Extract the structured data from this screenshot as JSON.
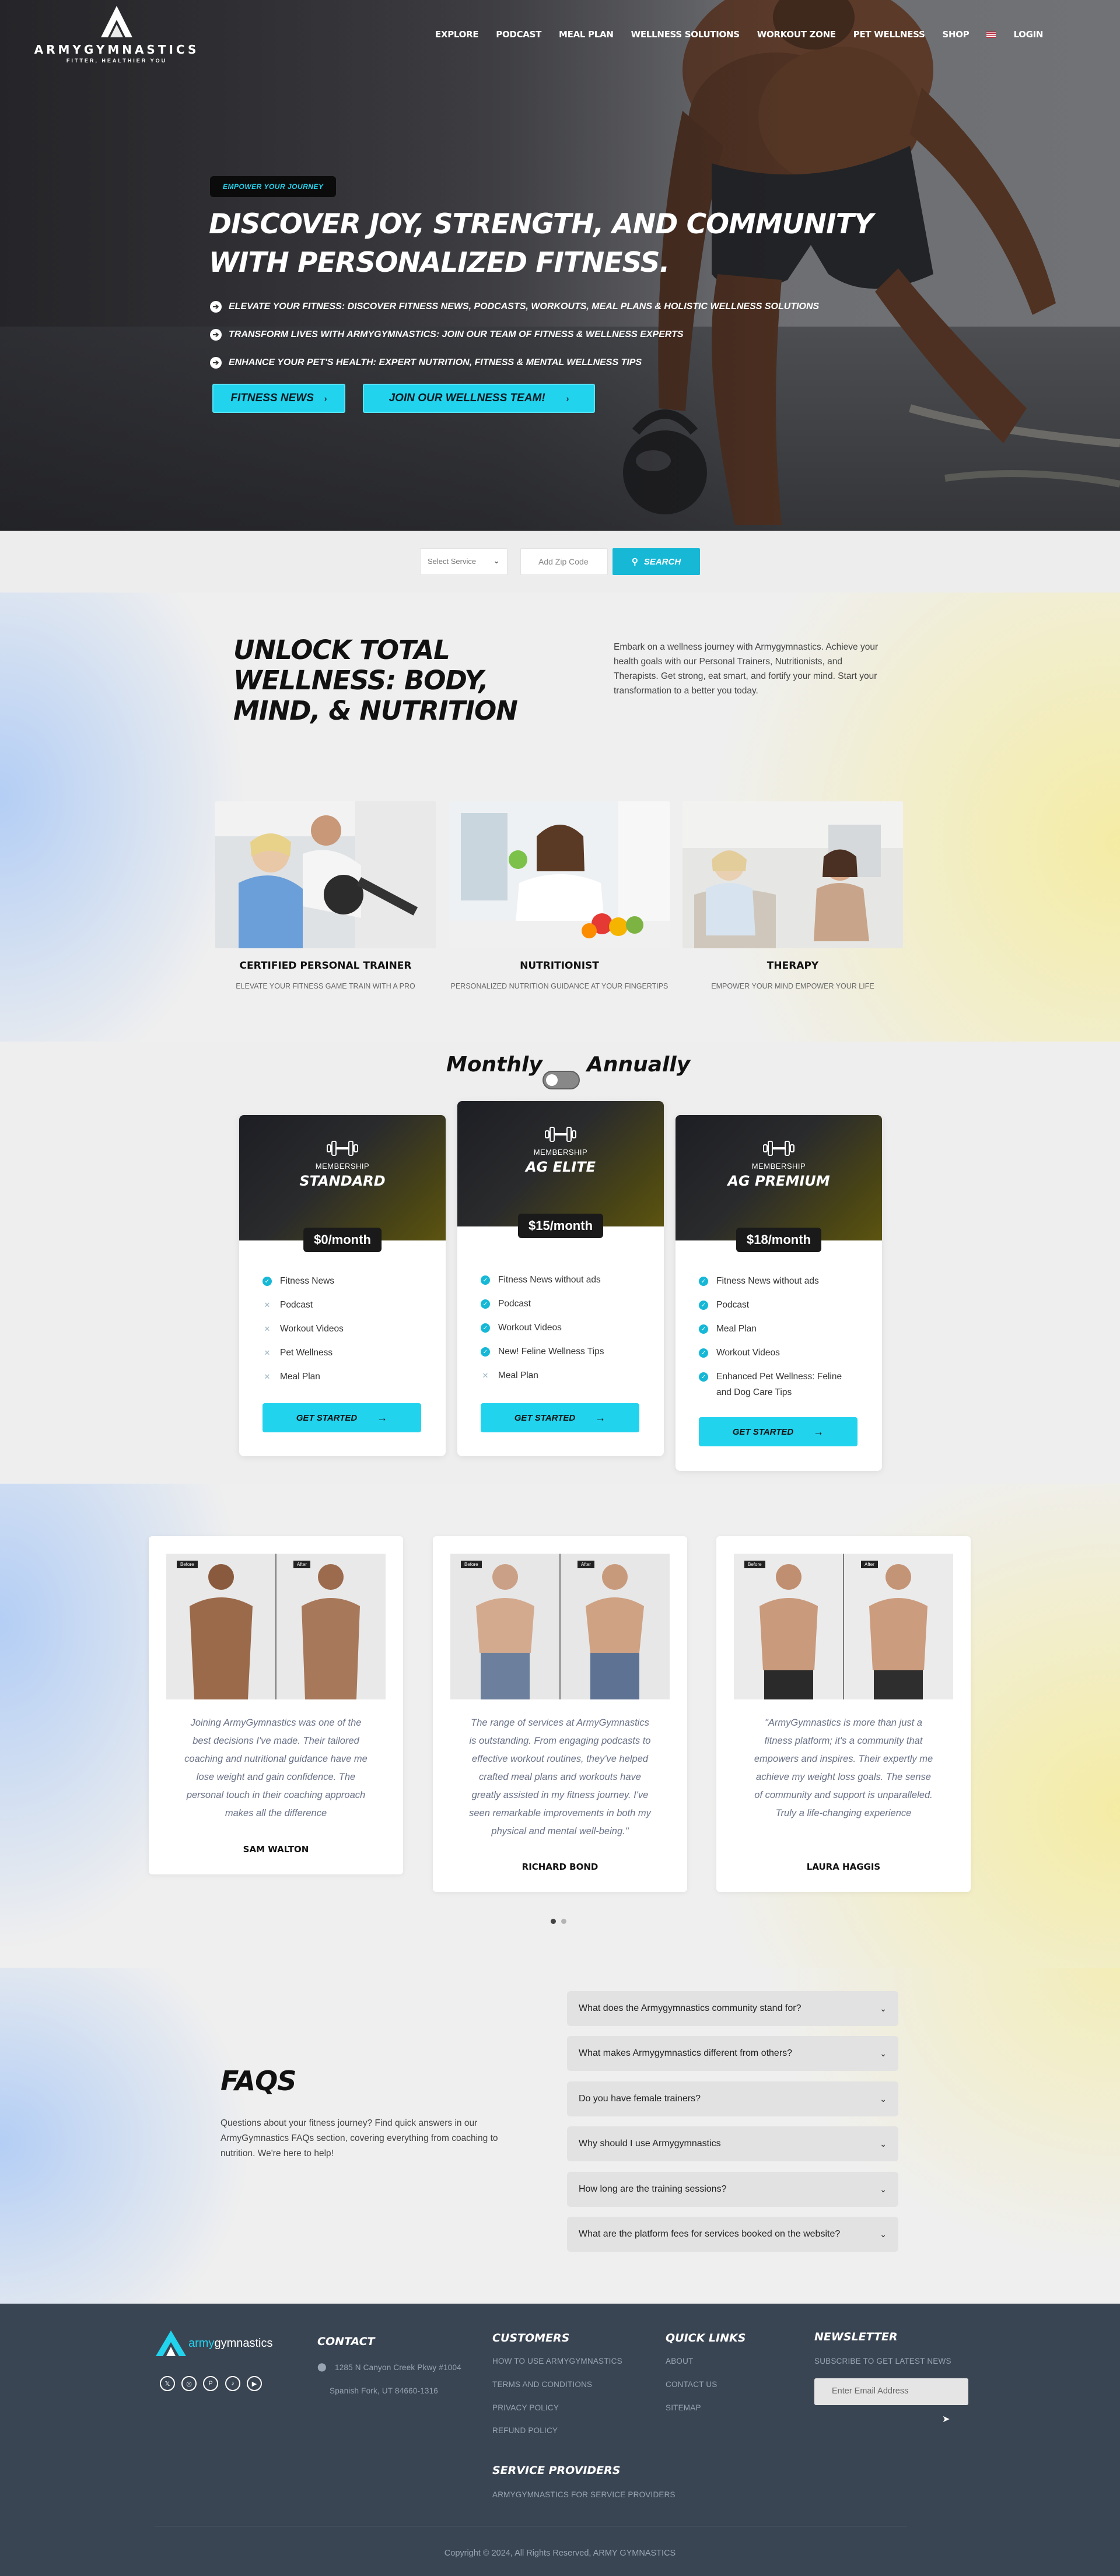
{
  "brand": {
    "name": "ARMYGYMNASTICS",
    "tagline": "FITTER, HEALTHIER YOU"
  },
  "nav": {
    "items": [
      "EXPLORE",
      "PODCAST",
      "MEAL PLAN",
      "WELLNESS SOLUTIONS",
      "WORKOUT ZONE",
      "PET WELLNESS",
      "SHOP"
    ],
    "login": "LOGIN"
  },
  "hero": {
    "badge": "EMPOWER YOUR JOURNEY",
    "title": "DISCOVER JOY, STRENGTH, AND COMMUNITY WITH PERSONALIZED FITNESS.",
    "bullets": [
      "ELEVATE YOUR FITNESS: DISCOVER FITNESS NEWS, PODCASTS, WORKOUTS, MEAL PLANS & HOLISTIC WELLNESS SOLUTIONS",
      "TRANSFORM LIVES WITH ARMYGYMNASTICS: JOIN OUR TEAM OF FITNESS & WELLNESS EXPERTS",
      "ENHANCE YOUR PET'S HEALTH: EXPERT NUTRITION, FITNESS & MENTAL WELLNESS TIPS"
    ],
    "cta_primary": "FITNESS NEWS",
    "cta_secondary": "JOIN OUR WELLNESS TEAM!"
  },
  "search": {
    "service_placeholder": "Select Service",
    "zip_placeholder": "Add Zip Code",
    "button": "SEARCH"
  },
  "wellness": {
    "title": "UNLOCK TOTAL WELLNESS: BODY, MIND, & NUTRITION",
    "description": "Embark on a wellness journey with Armygymnastics. Achieve your health goals with our Personal Trainers, Nutritionists, and Therapists. Get strong, eat smart, and fortify your mind. Start your transformation to a better you today.",
    "services": [
      {
        "name": "CERTIFIED PERSONAL TRAINER",
        "subtitle": "ELEVATE YOUR FITNESS GAME TRAIN WITH A PRO"
      },
      {
        "name": "NUTRITIONIST",
        "subtitle": "PERSONALIZED NUTRITION GUIDANCE AT YOUR FINGERTIPS"
      },
      {
        "name": "THERAPY",
        "subtitle": "EMPOWER YOUR MIND EMPOWER YOUR LIFE"
      }
    ]
  },
  "pricing": {
    "monthly": "Monthly",
    "annually": "Annually",
    "plans": [
      {
        "label": "MEMBERSHIP",
        "name": "STANDARD",
        "price": "$0/month",
        "features": [
          {
            "t": "Fitness News",
            "on": true
          },
          {
            "t": "Podcast",
            "on": false
          },
          {
            "t": "Workout Videos",
            "on": false
          },
          {
            "t": "Pet Wellness",
            "on": false
          },
          {
            "t": "Meal Plan",
            "on": false
          }
        ],
        "button": "GET STARTED"
      },
      {
        "label": "MEMBERSHIP",
        "name": "AG ELITE",
        "price": "$15/month",
        "features": [
          {
            "t": "Fitness News without ads",
            "on": true
          },
          {
            "t": "Podcast",
            "on": true
          },
          {
            "t": "Workout Videos",
            "on": true
          },
          {
            "t": "New! Feline Wellness Tips",
            "on": true
          },
          {
            "t": "Meal Plan",
            "on": false
          }
        ],
        "button": "GET STARTED"
      },
      {
        "label": "MEMBERSHIP",
        "name": "AG PREMIUM",
        "price": "$18/month",
        "features": [
          {
            "t": "Fitness News without ads",
            "on": true
          },
          {
            "t": "Podcast",
            "on": true
          },
          {
            "t": "Meal Plan",
            "on": true
          },
          {
            "t": "Workout Videos",
            "on": true
          },
          {
            "t": "Enhanced Pet Wellness: Feline and Dog Care Tips",
            "on": true
          }
        ],
        "button": "GET STARTED"
      }
    ]
  },
  "testimonials": {
    "before": "Before",
    "after": "After",
    "items": [
      {
        "quote": "Joining ArmyGymnastics was one of the best decisions I've made. Their tailored coaching and nutritional guidance have me lose weight and gain confidence. The personal touch in their coaching approach makes all the difference",
        "name": "SAM WALTON"
      },
      {
        "quote": "The range of services at ArmyGymnastics is outstanding. From engaging podcasts to effective workout routines, they've helped crafted meal plans and workouts have greatly assisted in my fitness journey. I've seen remarkable improvements in both my physical and mental well-being.\"",
        "name": "RICHARD BOND"
      },
      {
        "quote": "\"ArmyGymnastics is more than just a fitness platform; it's a community that empowers and inspires. Their expertly me achieve my weight loss goals. The sense of community and support is unparalleled. Truly a life-changing experience",
        "name": "LAURA HAGGIS"
      }
    ]
  },
  "faq": {
    "title": "FAQS",
    "description": "Questions about your fitness journey? Find quick answers in our ArmyGymnastics FAQs section, covering everything from coaching to nutrition. We're here to help!",
    "questions": [
      "What does the Armygymnastics community stand for?",
      "What makes Armygymnastics different from others?",
      "Do you have female trainers?",
      "Why should I use Armygymnastics",
      "How long are the training sessions?",
      "What are the platform fees for services booked on the website?"
    ]
  },
  "footer": {
    "logo_a": "army",
    "logo_b": "gymnastics",
    "contact_title": "CONTACT",
    "address1": "1285 N Canyon Creek Pkwy #1004",
    "address2": "Spanish Fork, UT 84660-1316",
    "customers_title": "CUSTOMERS",
    "customers": [
      "HOW TO USE ARMYGYMNASTICS",
      "TERMS AND CONDITIONS",
      "PRIVACY POLICY",
      "REFUND POLICY"
    ],
    "quick_title": "QUICK LINKS",
    "quick": [
      "ABOUT",
      "CONTACT US",
      "SITEMAP"
    ],
    "newsletter_title": "NEWSLETTER",
    "newsletter_sub": "SUBSCRIBE TO GET LATEST NEWS",
    "email_placeholder": "Enter Email Address",
    "providers_title": "SERVICE PROVIDERS",
    "providers_link": "ARMYGYMNASTICS FOR SERVICE PROVIDERS",
    "copyright": "Copyright © 2024, All Rights Reserved, ARMY GYMNASTICS"
  },
  "colors": {
    "accent": "#22d3ee",
    "dark": "#1a1a1a",
    "footer": "#3a4553"
  }
}
